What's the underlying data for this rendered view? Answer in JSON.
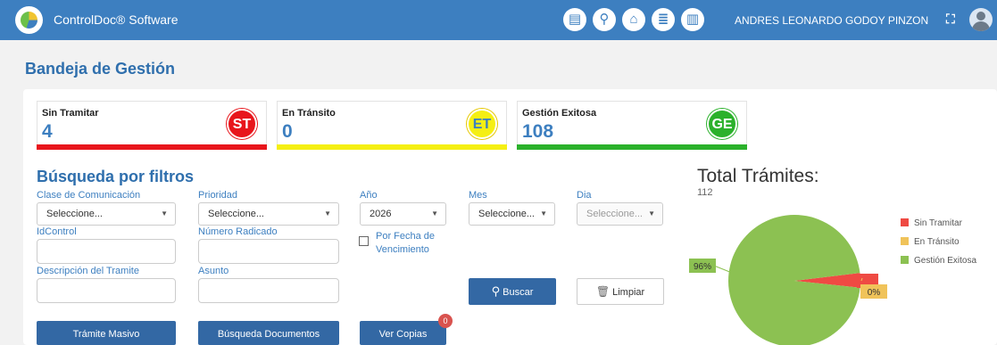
{
  "app": {
    "brand": "ControlDoc® Software",
    "user": "ANDRES LEONARDO GODOY PINZON"
  },
  "page": {
    "title": "Bandeja de Gestión"
  },
  "cards": [
    {
      "label": "Sin Tramitar",
      "value": "4",
      "badge": "ST",
      "color": "#e8161c"
    },
    {
      "label": "En Tránsito",
      "value": "0",
      "badge": "ET",
      "color": "#f5ef13"
    },
    {
      "label": "Gestión Exitosa",
      "value": "108",
      "badge": "GE",
      "color": "#2bb12b"
    }
  ],
  "filters": {
    "title": "Búsqueda por filtros",
    "clase": {
      "label": "Clase de Comunicación",
      "value": "Seleccione..."
    },
    "prioridad": {
      "label": "Prioridad",
      "value": "Seleccione..."
    },
    "anio": {
      "label": "Año",
      "value": "2026"
    },
    "mes": {
      "label": "Mes",
      "value": "Seleccione..."
    },
    "dia": {
      "label": "Dia",
      "value": "Seleccione..."
    },
    "idcontrol": {
      "label": "IdControl",
      "value": ""
    },
    "radicado": {
      "label": "Número Radicado",
      "value": ""
    },
    "fecha_venc": {
      "label": "Por Fecha de Vencimiento",
      "checked": false
    },
    "descripcion": {
      "label": "Descripción del Tramite",
      "value": ""
    },
    "asunto": {
      "label": "Asunto",
      "value": ""
    }
  },
  "buttons": {
    "buscar": "Buscar",
    "limpiar": "Limpiar",
    "tramite_masivo": "Trámite Masivo",
    "busqueda_documentos": "Búsqueda Documentos",
    "ver_copias": "Ver Copias",
    "ver_copias_count": "0"
  },
  "toolbar_icons": [
    "document-icon",
    "search-icon",
    "inbox-icon",
    "form-icon",
    "report-icon"
  ],
  "chart_data": {
    "type": "pie",
    "title": "Total Trámites:",
    "total": "112",
    "categories": [
      "Sin Tramitar",
      "En Tránsito",
      "Gestión Exitosa"
    ],
    "values": [
      4,
      0,
      108
    ],
    "colors": [
      "#ef4a43",
      "#f0c35a",
      "#8cc152"
    ],
    "data_labels": [
      "",
      "0%",
      "96%"
    ],
    "legend": "right"
  }
}
